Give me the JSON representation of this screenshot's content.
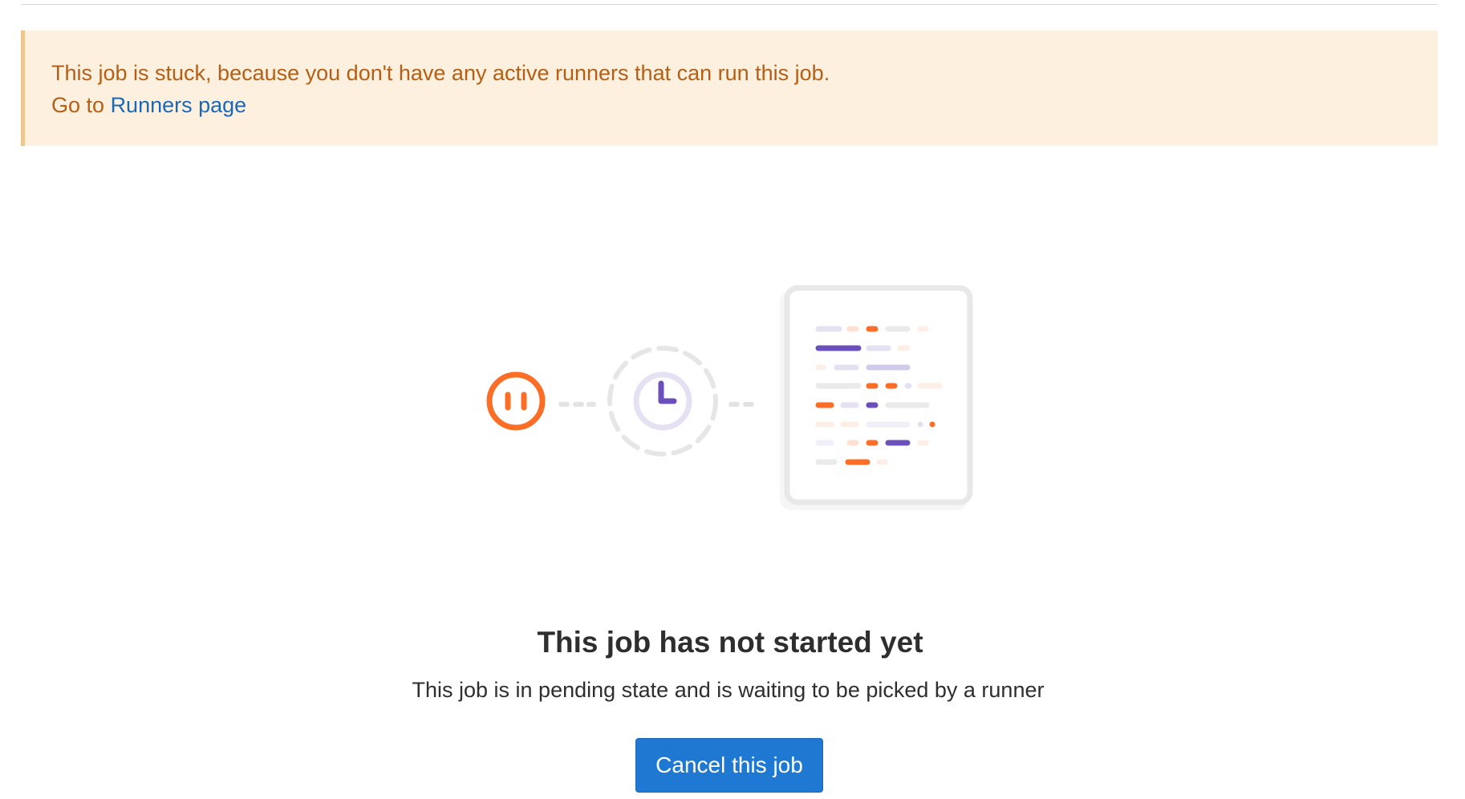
{
  "alert": {
    "message": "This job is stuck, because you don't have any active runners that can run this job.",
    "link_prefix": "Go to",
    "link_label": "Runners page"
  },
  "illustration": {
    "icons": [
      "pause-icon",
      "clock-icon",
      "job-log-document-icon"
    ],
    "colors": {
      "orange": "#fc6d26",
      "light_orange": "#fee1d3",
      "purple": "#6b4fbb",
      "lavender": "#d2caea",
      "light_lavender": "#e5e1f3",
      "grey": "#eaeaea",
      "document_border": "#e8e8e8"
    }
  },
  "empty_state": {
    "title": "This job has not started yet",
    "description": "This job is in pending state and is waiting to be picked by a runner",
    "cancel_button_label": "Cancel this job"
  },
  "colors": {
    "alert_background": "#fef0df",
    "alert_border": "#f0c68f",
    "alert_text": "#b55f16",
    "link": "#1b69b6",
    "primary_button": "#1f78d1"
  }
}
